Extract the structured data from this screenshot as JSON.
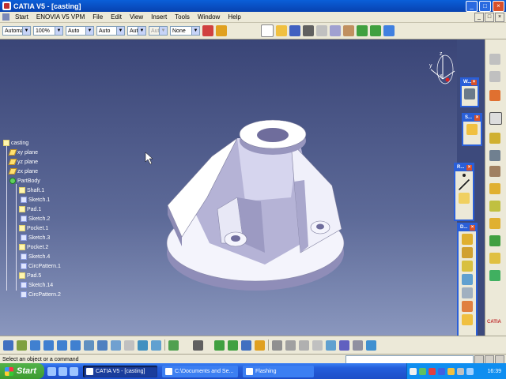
{
  "window": {
    "title": "CATIA V5 - [casting]"
  },
  "menu": [
    "Start",
    "ENOVIA V5 VPM",
    "File",
    "Edit",
    "View",
    "Insert",
    "Tools",
    "Window",
    "Help"
  ],
  "toolbar_combos": [
    {
      "value": "Automa",
      "w": 36
    },
    {
      "value": "100%",
      "w": 38
    },
    {
      "value": "Auto",
      "w": 36
    },
    {
      "value": "Auto",
      "w": 36
    },
    {
      "value": "Aut",
      "w": 24
    },
    {
      "value": "Aut",
      "w": 24,
      "disabled": true
    },
    {
      "value": "None",
      "w": 38
    }
  ],
  "tree": {
    "root": "casting",
    "items": [
      {
        "label": "xy plane",
        "kind": "pl"
      },
      {
        "label": "yz plane",
        "kind": "pl"
      },
      {
        "label": "zx plane",
        "kind": "pl"
      },
      {
        "label": "PartBody",
        "kind": "pb"
      },
      {
        "label": "Shaft.1",
        "kind": "ft"
      },
      {
        "label": "Sketch.1",
        "kind": "sk"
      },
      {
        "label": "Pad.1",
        "kind": "ft"
      },
      {
        "label": "Sketch.2",
        "kind": "sk"
      },
      {
        "label": "Pocket.1",
        "kind": "ft"
      },
      {
        "label": "Sketch.3",
        "kind": "sk"
      },
      {
        "label": "Pocket.2",
        "kind": "ft"
      },
      {
        "label": "Sketch.4",
        "kind": "sk"
      },
      {
        "label": "CircPattern.1",
        "kind": "sk"
      },
      {
        "label": "Pad.5",
        "kind": "ft"
      },
      {
        "label": "Sketch.14",
        "kind": "sk"
      },
      {
        "label": "CircPattern.2",
        "kind": "sk"
      }
    ]
  },
  "compass_axes": {
    "x": "x",
    "y": "y",
    "z": "z"
  },
  "panels": {
    "w": {
      "title": "W..."
    },
    "s": {
      "title": "S..."
    },
    "r": {
      "title": "R..."
    },
    "d": {
      "title": "D..."
    }
  },
  "catia_logo": "CATIA",
  "status": {
    "prompt": "Select an object or a command"
  },
  "taskbar": {
    "start": "Start",
    "tasks": [
      "CATIA V5 - [casting]",
      "C:\\Documents and Se...",
      "Flashing"
    ],
    "clock": "16:39"
  },
  "colors": {
    "accent": "#2a5fd8",
    "viewport_top": "#3a4577",
    "part_face": "#ffffff",
    "part_shade": "#b8b6d8"
  }
}
